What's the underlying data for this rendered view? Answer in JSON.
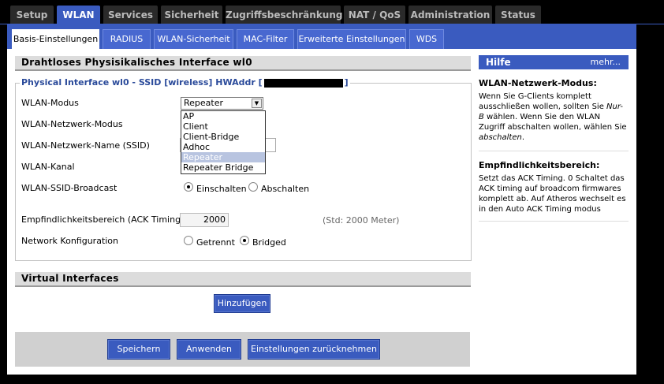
{
  "top_tabs": {
    "setup": "Setup",
    "wlan": "WLAN",
    "services": "Services",
    "security": "Sicherheit",
    "access": "Zugriffsbeschränkung",
    "nat": "NAT / QoS",
    "admin": "Administration",
    "status": "Status"
  },
  "sub_tabs": {
    "basic": "Basis-Einstellungen",
    "radius": "RADIUS",
    "wlan_security": "WLAN-Sicherheit",
    "mac_filter": "MAC-Filter",
    "advanced": "Erweiterte Einstellungen",
    "wds": "WDS"
  },
  "section1": {
    "title": "Drahtloses Physisikalisches Interface wl0",
    "legend": "Physical Interface wl0 - SSID [wireless] HWAddr [",
    "legend_end": "]"
  },
  "labels": {
    "mode": "WLAN-Modus",
    "net_mode": "WLAN-Netzwerk-Modus",
    "ssid": "WLAN-Netzwerk-Name (SSID)",
    "channel": "WLAN-Kanal",
    "broadcast": "WLAN-SSID-Broadcast",
    "ack": "Empfindlichkeitsbereich (ACK Timing)",
    "netconf": "Network Konfiguration"
  },
  "mode_select": {
    "value": "Repeater",
    "options": [
      "AP",
      "Client",
      "Client-Bridge",
      "Adhoc",
      "Repeater",
      "Repeater Bridge"
    ],
    "highlighted": "Repeater"
  },
  "broadcast": {
    "on": "Einschalten",
    "off": "Abschalten",
    "selected": "on"
  },
  "ack": {
    "value": "2000",
    "hint": "(Std: 2000 Meter)"
  },
  "netconf": {
    "unbridged": "Getrennt",
    "bridged": "Bridged",
    "selected": "bridged"
  },
  "virtual": {
    "title": "Virtual Interfaces",
    "add_button": "Hinzufügen"
  },
  "footer": {
    "save": "Speichern",
    "apply": "Anwenden",
    "reset": "Einstellungen zurücknehmen"
  },
  "help": {
    "title": "Hilfe",
    "more": "mehr...",
    "h1": "WLAN-Netzwerk-Modus:",
    "p1_a": "Wenn Sie G-Clients komplett ausschließen wollen, sollten Sie ",
    "p1_em1": "Nur-B",
    "p1_b": " wählen. Wenn Sie den WLAN Zugriff abschalten wollen, wählen Sie ",
    "p1_em2": "abschalten",
    "p1_c": ".",
    "h2": "Empfindlichkeitsbereich:",
    "p2": "Setzt das ACK Timing. 0 Schaltet das ACK timing auf broadcom firmwares komplett ab. Auf Atheros wechselt es in den Auto ACK Timing modus"
  },
  "colors": {
    "accent": "#3a5bbf",
    "tab_bg": "#2a2a2a",
    "section_bg": "#dcdcdc"
  }
}
